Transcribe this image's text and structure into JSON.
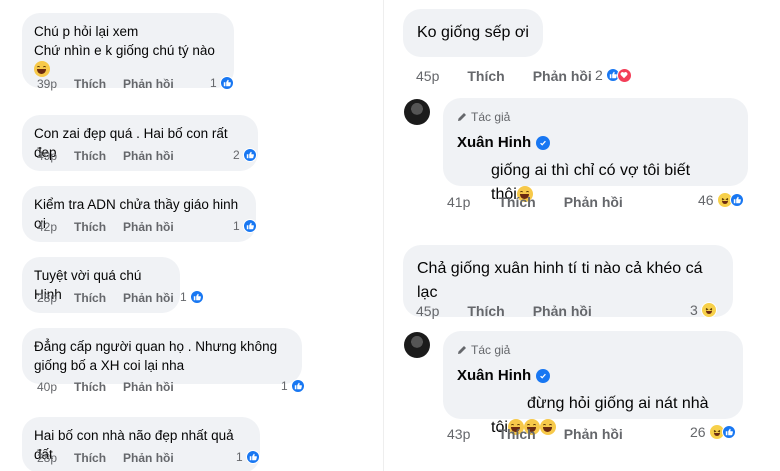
{
  "labels": {
    "like": "Thích",
    "reply": "Phản hồi",
    "author_tag": "Tác giả"
  },
  "left_comments": [
    {
      "lines": [
        "Chú p hỏi lại xem",
        "Chứ nhìn e k giống chú tý nào"
      ],
      "emoji": 1,
      "time": "39p",
      "reactions": "1"
    },
    {
      "lines": [
        "Con zai đẹp quá . Hai bố con rất đẹp"
      ],
      "emoji": 0,
      "time": "49p",
      "reactions": "2"
    },
    {
      "lines": [
        "Kiểm tra ADN chửa thầy giáo hinh ơi"
      ],
      "emoji": 0,
      "time": "42p",
      "reactions": "1"
    },
    {
      "lines": [
        "Tuyệt vời quá chú Hinh"
      ],
      "emoji": 0,
      "time": "28p",
      "reactions": "1"
    },
    {
      "lines": [
        "Đẳng cấp người quan họ . Nhưng không",
        "giống bố a XH coi lại nha"
      ],
      "emoji": 0,
      "time": "40p",
      "reactions": "1"
    },
    {
      "lines": [
        "Hai bố con nhà não đẹp nhất quả đất"
      ],
      "emoji": 0,
      "time": "28p",
      "reactions": "1"
    }
  ],
  "right_top": {
    "comment": {
      "text": "Ko giống sếp ơi",
      "time": "45p",
      "reactions": "2"
    },
    "reply": {
      "author": "Xuân Hinh",
      "lines": [
        "giống ai thì chỉ có vợ tôi biết",
        "thôi"
      ],
      "time": "41p",
      "reactions": "46"
    }
  },
  "right_bottom": {
    "comment": {
      "text": "Chả giống xuân hinh tí ti nào cả khéo cá lạc",
      "time": "45p",
      "reactions": "3"
    },
    "reply": {
      "author": "Xuân Hinh",
      "lines": [
        "đừng hỏi giống ai nát nhà",
        "tôi"
      ],
      "time": "43p",
      "reactions": "26"
    }
  },
  "colors": {
    "bubble": "#f0f2f5",
    "like_blue": "#1877f2",
    "heart_red": "#f33e58",
    "muted": "#65676b"
  }
}
